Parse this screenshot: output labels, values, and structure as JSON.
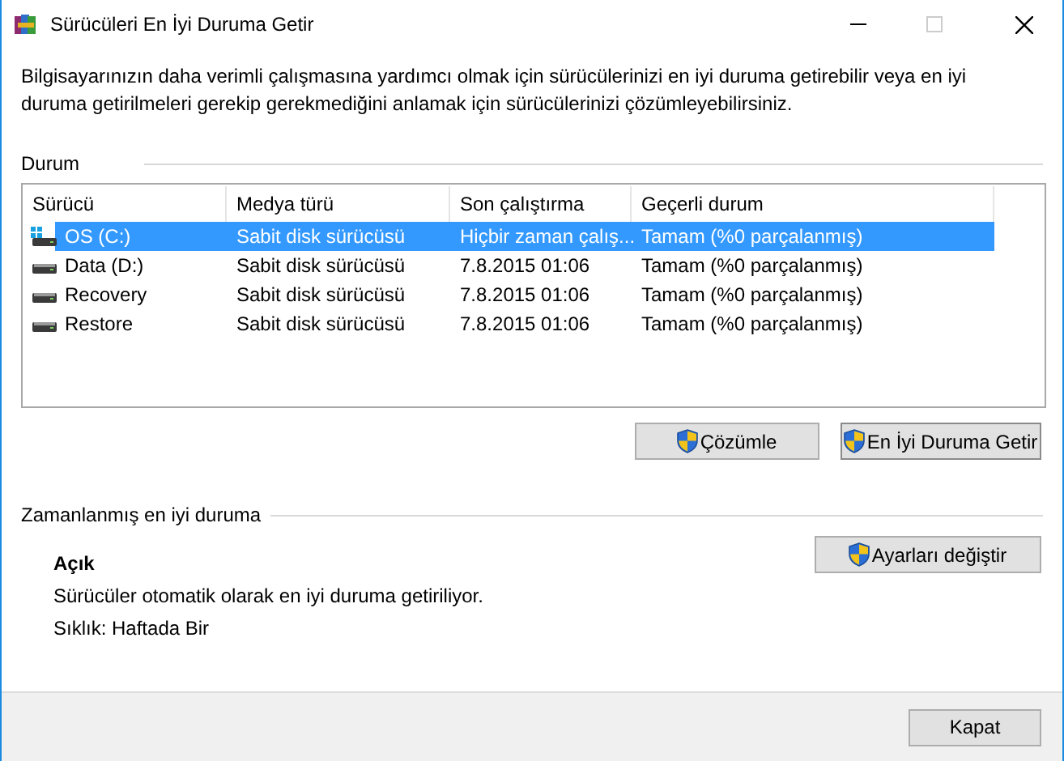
{
  "window": {
    "title": "Sürücüleri En İyi Duruma Getir"
  },
  "description": "Bilgisayarınızın daha verimli çalışmasına yardımcı olmak için sürücülerinizi en iyi duruma getirebilir veya en iyi duruma getirilmeleri gerekip gerekmediğini anlamak için sürücülerinizi çözümleyebilirsiniz.",
  "status_section": {
    "title": "Durum",
    "table": {
      "columns": [
        "Sürücü",
        "Medya türü",
        "Son çalıştırma",
        "Geçerli durum"
      ],
      "rows": [
        {
          "kind": "system",
          "selected": true,
          "cells": [
            "OS (C:)",
            "Sabit disk sürücüsü",
            "Hiçbir zaman çalış...",
            "Tamam (%0 parçalanmış)"
          ]
        },
        {
          "kind": "disk",
          "selected": false,
          "cells": [
            "Data (D:)",
            "Sabit disk sürücüsü",
            "7.8.2015 01:06",
            "Tamam (%0 parçalanmış)"
          ]
        },
        {
          "kind": "disk",
          "selected": false,
          "cells": [
            "Recovery",
            "Sabit disk sürücüsü",
            "7.8.2015 01:06",
            "Tamam (%0 parçalanmış)"
          ]
        },
        {
          "kind": "disk",
          "selected": false,
          "cells": [
            "Restore",
            "Sabit disk sürücüsü",
            "7.8.2015 01:06",
            "Tamam (%0 parçalanmış)"
          ]
        }
      ]
    },
    "buttons": [
      "Çözümle",
      "En İyi Duruma Getir"
    ]
  },
  "schedule_section": {
    "title": "Zamanlanmış en iyi duruma",
    "state": "Açık",
    "info": "Sürücüler otomatik olarak en iyi duruma getiriliyor.",
    "frequency": "Sıklık: Haftada Bir",
    "button": "Ayarları değiştir"
  },
  "footer": {
    "button": "Kapat"
  }
}
